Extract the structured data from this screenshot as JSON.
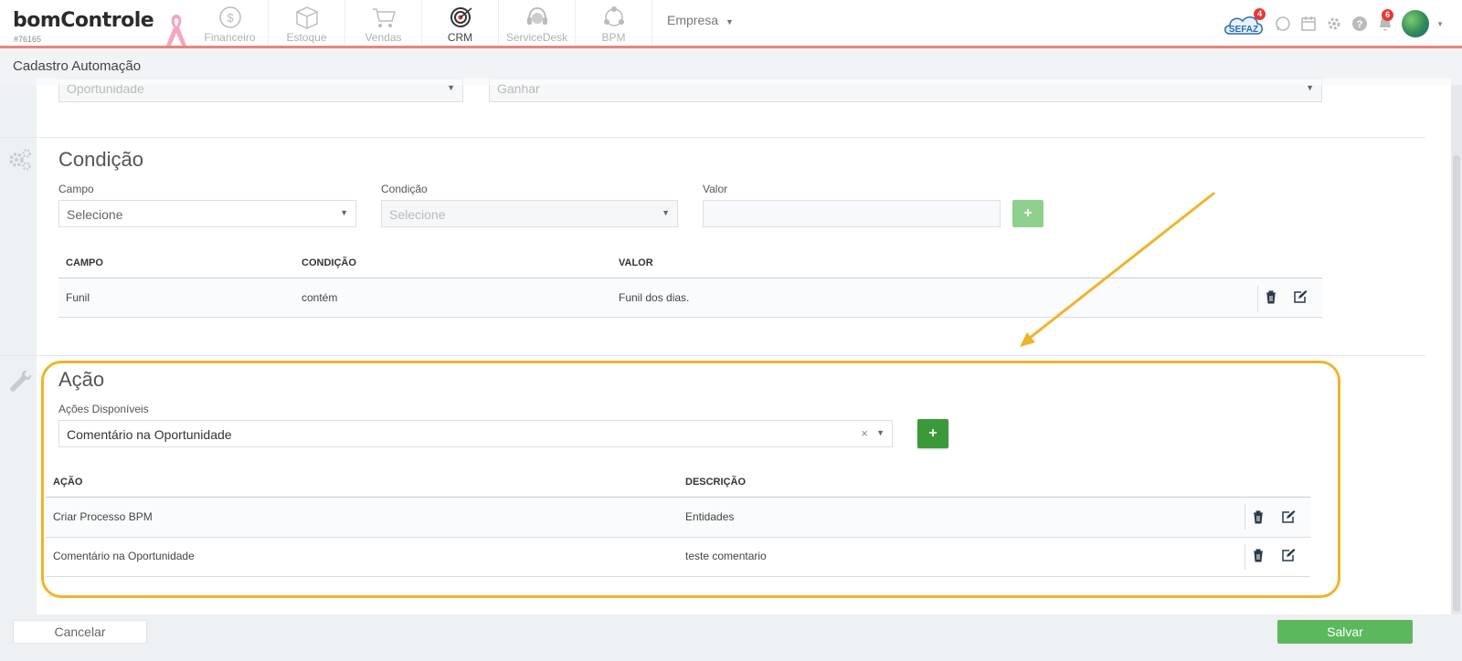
{
  "header": {
    "logo_text": "bomControle",
    "logo_id": "#76165",
    "modules": [
      {
        "label": "Financeiro",
        "icon": "coin-icon",
        "active": false
      },
      {
        "label": "Estoque",
        "icon": "box-icon",
        "active": false
      },
      {
        "label": "Vendas",
        "icon": "cart-icon",
        "active": false
      },
      {
        "label": "CRM",
        "icon": "target-icon",
        "active": true
      },
      {
        "label": "ServiceDesk",
        "icon": "headset-icon",
        "active": false
      },
      {
        "label": "BPM",
        "icon": "network-icon",
        "active": false
      }
    ],
    "empresa_label": "Empresa",
    "sefaz_label": "SEFAZ",
    "sefaz_badge": "4",
    "notifications_badge": "6"
  },
  "page": {
    "title": "Cadastro Automação"
  },
  "top_section": {
    "select_left": "Oportunidade",
    "select_right": "Ganhar"
  },
  "condicao": {
    "title": "Condição",
    "campo_label": "Campo",
    "campo_placeholder": "Selecione",
    "condicao_label": "Condição",
    "condicao_placeholder": "Selecione",
    "valor_label": "Valor",
    "add_symbol": "+",
    "columns": [
      "CAMPO",
      "CONDIÇÃO",
      "VALOR"
    ],
    "rows": [
      {
        "campo": "Funil",
        "condicao": "contém",
        "valor": "Funil dos dias."
      }
    ]
  },
  "acao": {
    "title": "Ação",
    "acoes_label": "Ações Disponíveis",
    "selected_action": "Comentário na Oportunidade",
    "clear_symbol": "×",
    "add_symbol": "+",
    "columns": [
      "AÇÃO",
      "DESCRIÇÃO"
    ],
    "rows": [
      {
        "acao": "Criar Processo BPM",
        "descricao": "Entidades"
      },
      {
        "acao": "Comentário na Oportunidade",
        "descricao": "teste comentario"
      }
    ]
  },
  "footer": {
    "cancel_label": "Cancelar",
    "save_label": "Salvar"
  },
  "colors": {
    "accent_green": "#5cb85c",
    "highlight": "#f0b429",
    "header_border": "#e8857a"
  }
}
